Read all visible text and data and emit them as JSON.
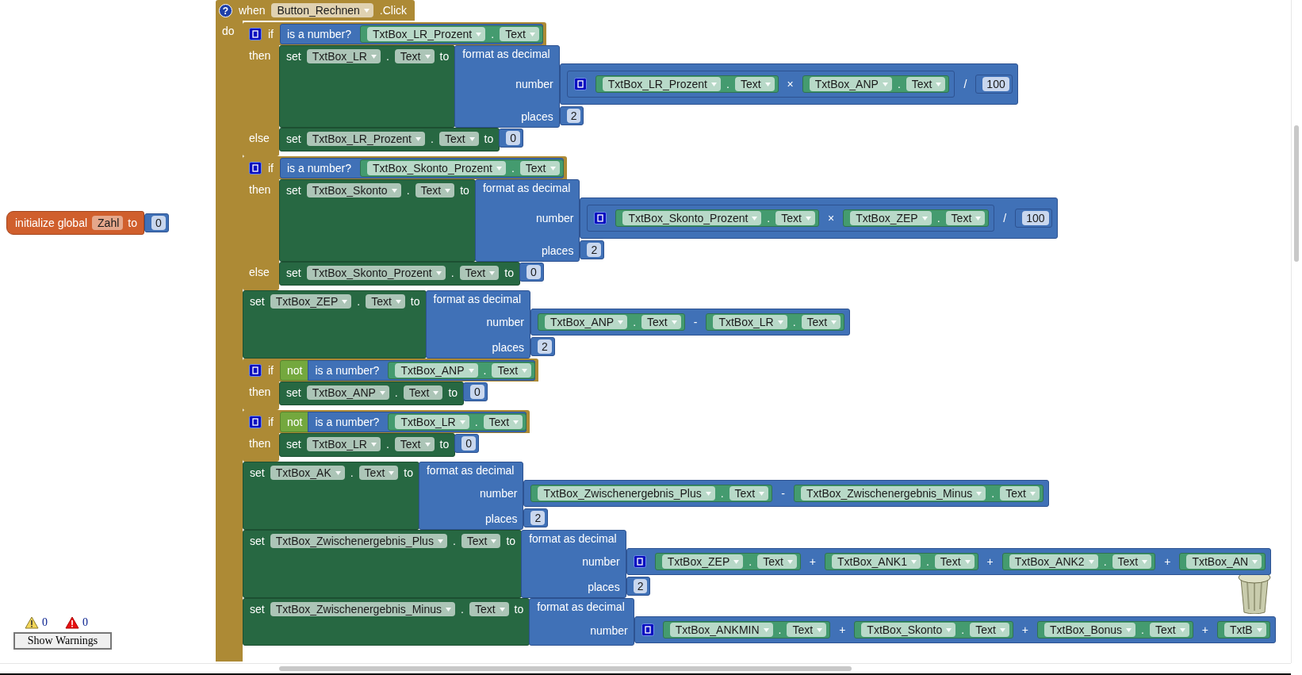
{
  "global_variable": {
    "label": "initialize global",
    "name": "Zahl",
    "to_label": "to",
    "value": {
      "kind": "number",
      "value": "0"
    }
  },
  "event": {
    "help": "?",
    "when_label": "when",
    "component": "Button_Rechnen",
    "event": ".Click",
    "do_label": "do",
    "statements": [
      {
        "kind": "if",
        "mutator": true,
        "if_label": "if",
        "condition": {
          "kind": "is_number",
          "label": "is a number?",
          "arg": {
            "kind": "get",
            "component": "TxtBox_LR_Prozent",
            "dot": ".",
            "property": "Text"
          }
        },
        "clauses": [
          {
            "label": "then",
            "statements": [
              {
                "kind": "set",
                "set_label": "set",
                "component": "TxtBox_LR",
                "dot": ".",
                "property": "Text",
                "to_label": "to",
                "value": {
                  "kind": "format",
                  "label": "format as decimal",
                  "inputs": [
                    {
                      "label": "number",
                      "value": {
                        "kind": "op",
                        "mutator": false,
                        "operators": [
                          "/"
                        ],
                        "operands": [
                          {
                            "kind": "op",
                            "mutator": true,
                            "operators": [
                              "×"
                            ],
                            "operands": [
                              {
                                "kind": "get",
                                "component": "TxtBox_LR_Prozent",
                                "dot": ".",
                                "property": "Text"
                              },
                              {
                                "kind": "get",
                                "component": "TxtBox_ANP",
                                "dot": ".",
                                "property": "Text"
                              }
                            ]
                          },
                          {
                            "kind": "number",
                            "value": "100"
                          }
                        ]
                      }
                    },
                    {
                      "label": "places",
                      "value": {
                        "kind": "number",
                        "value": "2"
                      }
                    }
                  ]
                }
              }
            ]
          },
          {
            "label": "else",
            "statements": [
              {
                "kind": "set",
                "set_label": "set",
                "component": "TxtBox_LR_Prozent",
                "dot": ".",
                "property": "Text",
                "to_label": "to",
                "value": {
                  "kind": "number",
                  "value": "0"
                }
              }
            ]
          }
        ]
      },
      {
        "kind": "if",
        "mutator": true,
        "if_label": "if",
        "condition": {
          "kind": "is_number",
          "label": "is a number?",
          "arg": {
            "kind": "get",
            "component": "TxtBox_Skonto_Prozent",
            "dot": ".",
            "property": "Text"
          }
        },
        "clauses": [
          {
            "label": "then",
            "statements": [
              {
                "kind": "set",
                "set_label": "set",
                "component": "TxtBox_Skonto",
                "dot": ".",
                "property": "Text",
                "to_label": "to",
                "value": {
                  "kind": "format",
                  "label": "format as decimal",
                  "inputs": [
                    {
                      "label": "number",
                      "value": {
                        "kind": "op",
                        "mutator": false,
                        "operators": [
                          "/"
                        ],
                        "operands": [
                          {
                            "kind": "op",
                            "mutator": true,
                            "operators": [
                              "×"
                            ],
                            "operands": [
                              {
                                "kind": "get",
                                "component": "TxtBox_Skonto_Prozent",
                                "dot": ".",
                                "property": "Text"
                              },
                              {
                                "kind": "get",
                                "component": "TxtBox_ZEP",
                                "dot": ".",
                                "property": "Text"
                              }
                            ]
                          },
                          {
                            "kind": "number",
                            "value": "100"
                          }
                        ]
                      }
                    },
                    {
                      "label": "places",
                      "value": {
                        "kind": "number",
                        "value": "2"
                      }
                    }
                  ]
                }
              }
            ]
          },
          {
            "label": "else",
            "statements": [
              {
                "kind": "set",
                "set_label": "set",
                "component": "TxtBox_Skonto_Prozent",
                "dot": ".",
                "property": "Text",
                "to_label": "to",
                "value": {
                  "kind": "number",
                  "value": "0"
                }
              }
            ]
          }
        ]
      },
      {
        "kind": "set",
        "set_label": "set",
        "component": "TxtBox_ZEP",
        "dot": ".",
        "property": "Text",
        "to_label": "to",
        "value": {
          "kind": "format",
          "label": "format as decimal",
          "inputs": [
            {
              "label": "number",
              "value": {
                "kind": "op",
                "mutator": false,
                "operators": [
                  "-"
                ],
                "operands": [
                  {
                    "kind": "get",
                    "component": "TxtBox_ANP",
                    "dot": ".",
                    "property": "Text"
                  },
                  {
                    "kind": "get",
                    "component": "TxtBox_LR",
                    "dot": ".",
                    "property": "Text"
                  }
                ]
              }
            },
            {
              "label": "places",
              "value": {
                "kind": "number",
                "value": "2"
              }
            }
          ]
        }
      },
      {
        "kind": "if",
        "mutator": true,
        "if_label": "if",
        "condition": {
          "kind": "not",
          "label": "not",
          "arg": {
            "kind": "is_number",
            "label": "is a number?",
            "arg": {
              "kind": "get",
              "component": "TxtBox_ANP",
              "dot": ".",
              "property": "Text"
            }
          }
        },
        "clauses": [
          {
            "label": "then",
            "statements": [
              {
                "kind": "set",
                "set_label": "set",
                "component": "TxtBox_ANP",
                "dot": ".",
                "property": "Text",
                "to_label": "to",
                "value": {
                  "kind": "number",
                  "value": "0"
                }
              }
            ]
          }
        ]
      },
      {
        "kind": "if",
        "mutator": true,
        "if_label": "if",
        "condition": {
          "kind": "not",
          "label": "not",
          "arg": {
            "kind": "is_number",
            "label": "is a number?",
            "arg": {
              "kind": "get",
              "component": "TxtBox_LR",
              "dot": ".",
              "property": "Text"
            }
          }
        },
        "clauses": [
          {
            "label": "then",
            "statements": [
              {
                "kind": "set",
                "set_label": "set",
                "component": "TxtBox_LR",
                "dot": ".",
                "property": "Text",
                "to_label": "to",
                "value": {
                  "kind": "number",
                  "value": "0"
                }
              }
            ]
          }
        ]
      },
      {
        "kind": "set",
        "set_label": "set",
        "component": "TxtBox_AK",
        "dot": ".",
        "property": "Text",
        "to_label": "to",
        "value": {
          "kind": "format",
          "label": "format as decimal",
          "inputs": [
            {
              "label": "number",
              "value": {
                "kind": "op",
                "mutator": false,
                "operators": [
                  "-"
                ],
                "operands": [
                  {
                    "kind": "get",
                    "component": "TxtBox_Zwischenergebnis_Plus",
                    "dot": ".",
                    "property": "Text"
                  },
                  {
                    "kind": "get",
                    "component": "TxtBox_Zwischenergebnis_Minus",
                    "dot": ".",
                    "property": "Text"
                  }
                ]
              }
            },
            {
              "label": "places",
              "value": {
                "kind": "number",
                "value": "2"
              }
            }
          ]
        }
      },
      {
        "kind": "set",
        "set_label": "set",
        "component": "TxtBox_Zwischenergebnis_Plus",
        "dot": ".",
        "property": "Text",
        "to_label": "to",
        "value": {
          "kind": "format",
          "label": "format as decimal",
          "inputs": [
            {
              "label": "number",
              "value": {
                "kind": "op",
                "mutator": true,
                "operators": [
                  "+",
                  "+",
                  "+"
                ],
                "operands": [
                  {
                    "kind": "get",
                    "component": "TxtBox_ZEP",
                    "dot": ".",
                    "property": "Text"
                  },
                  {
                    "kind": "get",
                    "component": "TxtBox_ANK1",
                    "dot": ".",
                    "property": "Text"
                  },
                  {
                    "kind": "get",
                    "component": "TxtBox_ANK2",
                    "dot": ".",
                    "property": "Text"
                  },
                  {
                    "kind": "get",
                    "component": "TxtBox_AN"
                  }
                ]
              }
            },
            {
              "label": "places",
              "value": {
                "kind": "number",
                "value": "2"
              }
            }
          ]
        }
      },
      {
        "kind": "set",
        "set_label": "set",
        "component": "TxtBox_Zwischenergebnis_Minus",
        "dot": ".",
        "property": "Text",
        "to_label": "to",
        "value": {
          "kind": "format",
          "label": "format as decimal",
          "inputs": [
            {
              "label": "number",
              "value": {
                "kind": "op",
                "mutator": true,
                "operators": [
                  "+",
                  "+",
                  "+"
                ],
                "operands": [
                  {
                    "kind": "get",
                    "component": "TxtBox_ANKMIN",
                    "dot": ".",
                    "property": "Text"
                  },
                  {
                    "kind": "get",
                    "component": "TxtBox_Skonto",
                    "dot": ".",
                    "property": "Text"
                  },
                  {
                    "kind": "get",
                    "component": "TxtBox_Bonus",
                    "dot": ".",
                    "property": "Text"
                  },
                  {
                    "kind": "get",
                    "component": "TxtB"
                  }
                ]
              }
            }
          ]
        }
      }
    ]
  },
  "warnings": {
    "warning_count": "0",
    "error_count": "0",
    "button": "Show Warnings"
  }
}
